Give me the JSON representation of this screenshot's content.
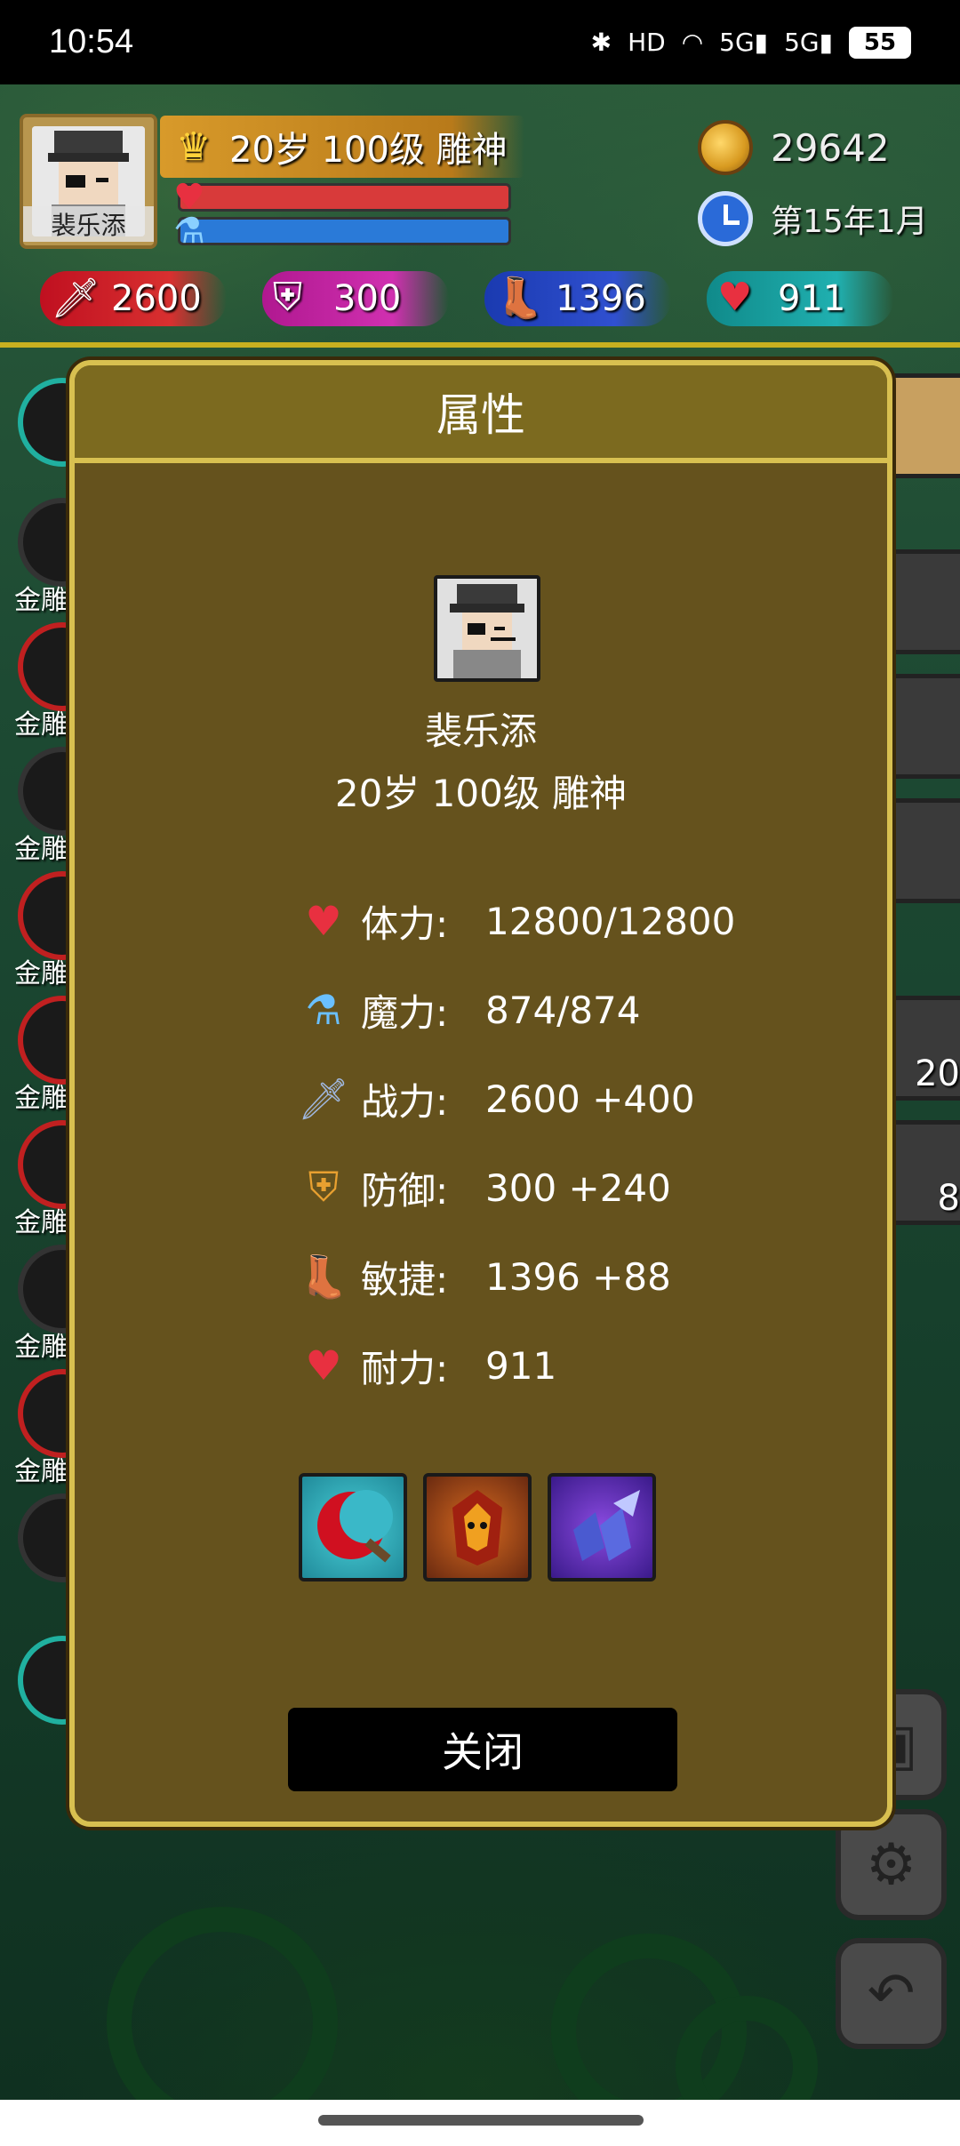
{
  "statusbar": {
    "time": "10:54",
    "battery": "55"
  },
  "player": {
    "name": "裴乐添",
    "title": "20岁 100级 雕神",
    "gold": "29642",
    "date": "第15年1月"
  },
  "stats": {
    "attack": "2600",
    "defense": "300",
    "agility": "1396",
    "stamina": "911"
  },
  "left_list": {
    "label": "金雕"
  },
  "right_slots": {
    "red_potion_count": "20",
    "blue_potion_count": "8"
  },
  "modal": {
    "title": "属性",
    "name": "裴乐添",
    "subtitle": "20岁 100级 雕神",
    "attributes": [
      {
        "label": "体力:",
        "value": "12800/12800",
        "icon": "heart-icon"
      },
      {
        "label": "魔力:",
        "value": "874/874",
        "icon": "potion-icon"
      },
      {
        "label": "战力:",
        "value": "2600 +400",
        "icon": "sword-icon"
      },
      {
        "label": "防御:",
        "value": "300 +240",
        "icon": "shield-icon"
      },
      {
        "label": "敏捷:",
        "value": "1396 +88",
        "icon": "boot-icon"
      },
      {
        "label": "耐力:",
        "value": "911",
        "icon": "heart-plus-icon"
      }
    ],
    "equipment": [
      "crescent-blade-icon",
      "demon-armor-icon",
      "winged-boots-icon"
    ],
    "close_label": "关闭"
  },
  "colors": {
    "modal_bg": "#65521d",
    "modal_border": "#d8c050",
    "hp": "#d83a3a",
    "mp": "#2a7ad8"
  }
}
